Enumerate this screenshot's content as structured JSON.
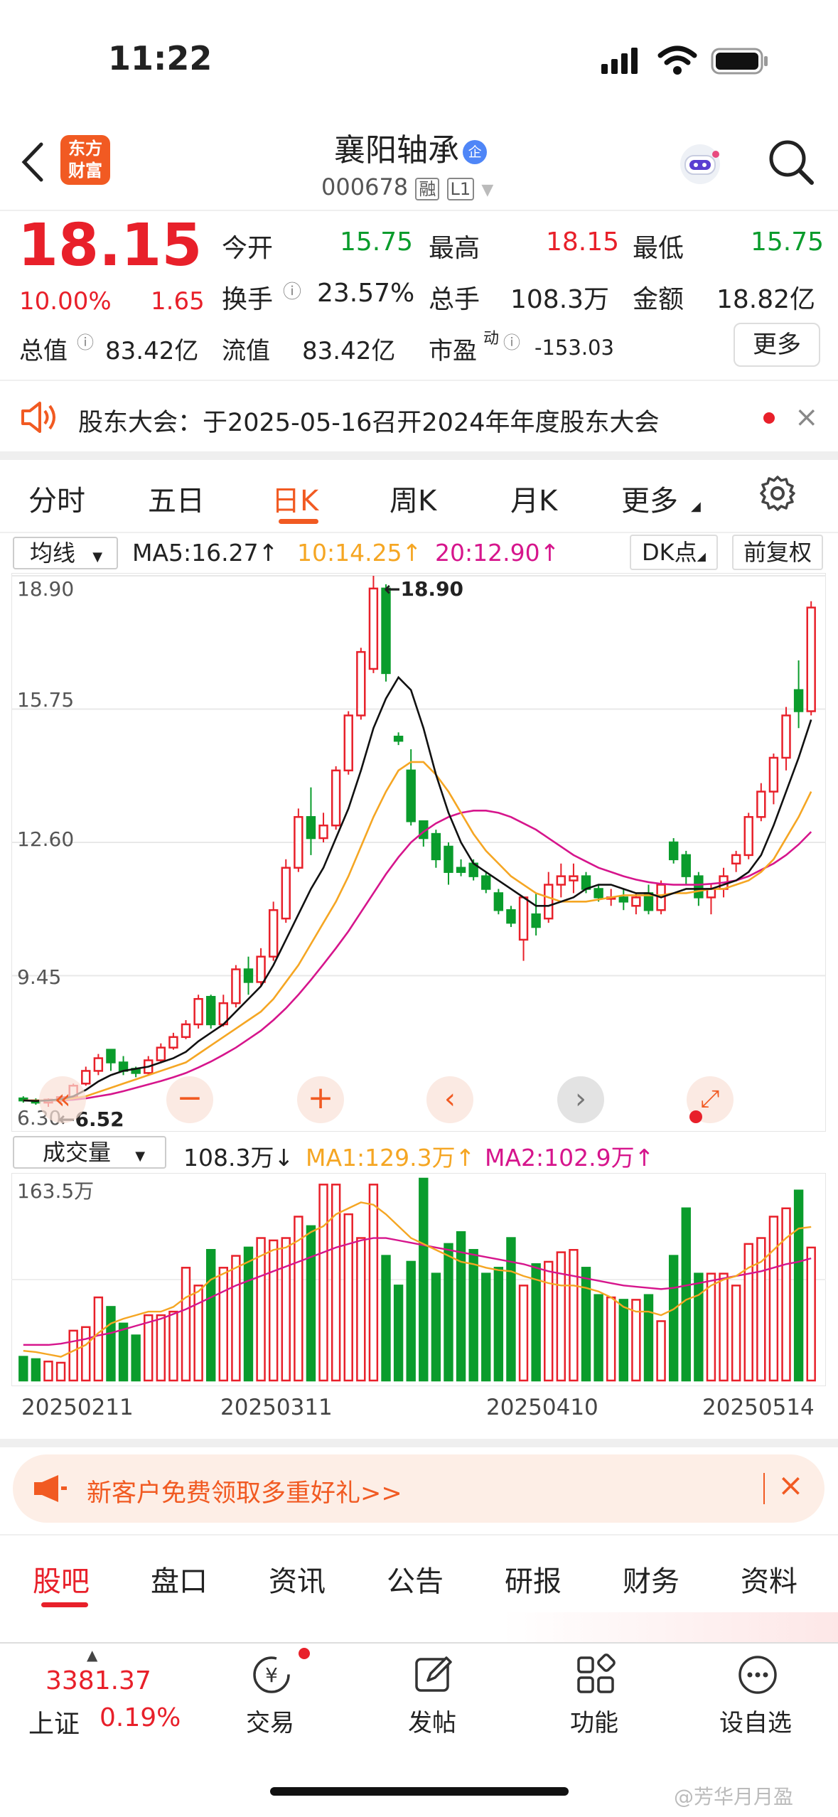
{
  "status_bar": {
    "time": "11:22"
  },
  "header": {
    "logo": "东方\n财富",
    "logo_line1": "东方",
    "logo_line2": "财富",
    "stock_name": "襄阳轴承",
    "badge": "企",
    "stock_code": "000678",
    "tag_rong": "融",
    "tag_level": "L1"
  },
  "quote": {
    "price": "18.15",
    "change_pct": "10.00%",
    "change": "1.65",
    "open_label": "今开",
    "open": "15.75",
    "high_label": "最高",
    "high": "18.15",
    "low_label": "最低",
    "low": "15.75",
    "turnover_label": "换手",
    "turnover": "23.57%",
    "volume_label": "总手",
    "volume": "108.3万",
    "amount_label": "金额",
    "amount": "18.82亿",
    "mktcap_label": "总值",
    "mktcap": "83.42亿",
    "float_label": "流值",
    "float_cap": "83.42亿",
    "pe_label": "市盈",
    "pe_sup": "动",
    "pe": "-153.03",
    "more_button": "更多"
  },
  "notice": {
    "text": "股东大会：于2025-05-16召开2024年年度股东大会"
  },
  "chart_tabs": [
    "分时",
    "五日",
    "日K",
    "周K",
    "月K",
    "更多"
  ],
  "active_tab": "日K",
  "ma_bar": {
    "selector": "均线",
    "ma5": "MA5:16.27↑",
    "ma10": "10:14.25↑",
    "ma20": "20:12.90↑",
    "dk": "DK点",
    "adj": "前复权"
  },
  "price_axis": [
    "18.90",
    "15.75",
    "12.60",
    "9.45",
    "6.30"
  ],
  "price_annotations": {
    "high_mark": "←18.90",
    "low_mark": "←6.52"
  },
  "volume_bar": {
    "selector": "成交量",
    "vol": "108.3万↓",
    "ma1": "MA1:129.3万↑",
    "ma2": "MA2:102.9万↑",
    "max_label": "163.5万"
  },
  "date_axis": [
    "20250211",
    "20250311",
    "20250410",
    "20250514"
  ],
  "promo": {
    "text": "新客户免费领取多重好礼>>"
  },
  "bottom_tabs": [
    "股吧",
    "盘口",
    "资讯",
    "公告",
    "研报",
    "财务",
    "资料"
  ],
  "active_bottom_tab": "股吧",
  "nav": {
    "index_value": "3381.37",
    "index_name": "上证",
    "index_change": "0.19%",
    "items": [
      "交易",
      "发帖",
      "功能",
      "设自选"
    ]
  },
  "watermark": "@芳华月月盈",
  "colors": {
    "up": "#e8202a",
    "down": "#0a9c2c",
    "accent": "#f15a22",
    "ma5": "#111111",
    "ma10": "#f5a623",
    "ma20": "#d6158c"
  },
  "chart_data": {
    "type": "candlestick",
    "price_axis_range": [
      6.3,
      18.9
    ],
    "candles": [
      [
        6.55,
        6.6,
        6.45,
        6.5
      ],
      [
        6.5,
        6.55,
        6.4,
        6.45
      ],
      [
        6.45,
        6.55,
        6.35,
        6.52
      ],
      [
        6.5,
        6.62,
        6.45,
        6.58
      ],
      [
        6.58,
        6.9,
        6.55,
        6.85
      ],
      [
        6.9,
        7.3,
        6.85,
        7.2
      ],
      [
        7.2,
        7.6,
        7.1,
        7.5
      ],
      [
        7.7,
        7.6,
        7.2,
        7.4
      ],
      [
        7.4,
        7.55,
        7.1,
        7.2
      ],
      [
        7.25,
        7.3,
        7.05,
        7.15
      ],
      [
        7.15,
        7.55,
        7.1,
        7.45
      ],
      [
        7.45,
        7.85,
        7.4,
        7.75
      ],
      [
        7.75,
        8.1,
        7.7,
        8.0
      ],
      [
        8.0,
        8.4,
        7.95,
        8.3
      ],
      [
        8.3,
        9.0,
        8.2,
        8.9
      ],
      [
        8.95,
        9.0,
        8.2,
        8.3
      ],
      [
        8.3,
        9.0,
        8.25,
        8.8
      ],
      [
        8.8,
        9.7,
        8.7,
        9.6
      ],
      [
        9.6,
        9.9,
        9.0,
        9.3
      ],
      [
        9.3,
        10.1,
        9.2,
        9.9
      ],
      [
        9.9,
        11.2,
        9.8,
        11.0
      ],
      [
        10.8,
        12.2,
        10.7,
        12.0
      ],
      [
        12.0,
        13.4,
        11.9,
        13.2
      ],
      [
        13.2,
        13.9,
        12.3,
        12.7
      ],
      [
        12.7,
        13.3,
        12.6,
        13.0
      ],
      [
        13.0,
        14.4,
        12.9,
        14.3
      ],
      [
        14.3,
        15.7,
        14.2,
        15.6
      ],
      [
        15.6,
        17.2,
        15.5,
        17.1
      ],
      [
        16.7,
        18.9,
        16.6,
        18.6
      ],
      [
        18.6,
        18.7,
        16.4,
        16.6
      ],
      [
        15.1,
        15.2,
        14.9,
        15.0
      ],
      [
        14.3,
        14.8,
        13.0,
        13.1
      ],
      [
        13.1,
        13.1,
        12.5,
        12.7
      ],
      [
        12.8,
        12.9,
        12.0,
        12.2
      ],
      [
        12.5,
        12.6,
        11.6,
        11.9
      ],
      [
        12.0,
        12.2,
        11.8,
        11.9
      ],
      [
        12.1,
        12.2,
        11.7,
        11.8
      ],
      [
        11.8,
        11.9,
        11.4,
        11.5
      ],
      [
        11.4,
        11.5,
        10.9,
        11.0
      ],
      [
        11.0,
        11.1,
        10.6,
        10.7
      ],
      [
        10.3,
        11.3,
        9.8,
        11.3
      ],
      [
        10.9,
        11.4,
        10.4,
        10.6
      ],
      [
        10.8,
        11.9,
        10.7,
        11.6
      ],
      [
        11.6,
        12.1,
        11.3,
        11.8
      ],
      [
        11.7,
        12.1,
        11.4,
        11.8
      ],
      [
        11.8,
        11.9,
        11.4,
        11.5
      ],
      [
        11.5,
        11.6,
        11.2,
        11.3
      ],
      [
        11.3,
        11.5,
        11.1,
        11.3
      ],
      [
        11.3,
        11.5,
        11.0,
        11.2
      ],
      [
        11.1,
        11.4,
        10.9,
        11.3
      ],
      [
        11.4,
        11.6,
        10.9,
        11.0
      ],
      [
        11.0,
        11.7,
        10.9,
        11.6
      ],
      [
        12.6,
        12.7,
        12.1,
        12.2
      ],
      [
        12.3,
        12.4,
        11.6,
        11.8
      ],
      [
        11.8,
        11.9,
        11.1,
        11.3
      ],
      [
        11.3,
        11.6,
        10.9,
        11.5
      ],
      [
        11.5,
        12.0,
        11.3,
        11.8
      ],
      [
        12.1,
        12.4,
        11.9,
        12.3
      ],
      [
        12.3,
        13.3,
        12.2,
        13.2
      ],
      [
        13.2,
        14.0,
        13.1,
        13.8
      ],
      [
        13.8,
        14.7,
        13.5,
        14.6
      ],
      [
        14.6,
        15.8,
        14.3,
        15.6
      ],
      [
        16.2,
        16.9,
        15.3,
        15.7
      ],
      [
        15.7,
        18.3,
        15.6,
        18.15
      ]
    ],
    "ma5": [
      6.5,
      6.49,
      6.5,
      6.53,
      6.6,
      6.75,
      6.95,
      7.1,
      7.2,
      7.25,
      7.3,
      7.4,
      7.5,
      7.65,
      7.9,
      8.1,
      8.3,
      8.6,
      8.9,
      9.2,
      9.7,
      10.3,
      10.9,
      11.5,
      12.0,
      12.7,
      13.4,
      14.3,
      15.3,
      16.0,
      16.5,
      16.2,
      15.3,
      14.2,
      13.3,
      12.6,
      12.1,
      11.9,
      11.7,
      11.5,
      11.3,
      11.1,
      11.1,
      11.2,
      11.3,
      11.5,
      11.6,
      11.6,
      11.5,
      11.4,
      11.4,
      11.3,
      11.4,
      11.5,
      11.5,
      11.5,
      11.6,
      11.7,
      11.9,
      12.3,
      13.0,
      13.8,
      14.6,
      15.5
    ],
    "ma10": [
      6.5,
      6.5,
      6.5,
      6.51,
      6.55,
      6.6,
      6.7,
      6.8,
      6.9,
      7.0,
      7.1,
      7.2,
      7.3,
      7.4,
      7.6,
      7.8,
      8.0,
      8.2,
      8.4,
      8.6,
      8.9,
      9.3,
      9.7,
      10.2,
      10.7,
      11.2,
      11.8,
      12.5,
      13.2,
      13.8,
      14.3,
      14.5,
      14.5,
      14.2,
      13.8,
      13.3,
      12.8,
      12.4,
      12.1,
      11.8,
      11.6,
      11.4,
      11.3,
      11.2,
      11.2,
      11.2,
      11.25,
      11.3,
      11.35,
      11.35,
      11.35,
      11.35,
      11.4,
      11.4,
      11.45,
      11.5,
      11.5,
      11.6,
      11.7,
      11.9,
      12.2,
      12.7,
      13.2,
      13.8
    ],
    "ma20": [
      6.5,
      6.5,
      6.5,
      6.5,
      6.52,
      6.55,
      6.6,
      6.65,
      6.72,
      6.8,
      6.88,
      6.96,
      7.05,
      7.15,
      7.28,
      7.42,
      7.58,
      7.75,
      7.95,
      8.15,
      8.4,
      8.68,
      9.0,
      9.35,
      9.72,
      10.1,
      10.5,
      10.95,
      11.4,
      11.85,
      12.25,
      12.6,
      12.85,
      13.05,
      13.2,
      13.3,
      13.35,
      13.35,
      13.3,
      13.2,
      13.05,
      12.9,
      12.7,
      12.5,
      12.3,
      12.15,
      12.0,
      11.9,
      11.8,
      11.72,
      11.66,
      11.62,
      11.6,
      11.6,
      11.6,
      11.62,
      11.65,
      11.7,
      11.8,
      11.95,
      12.1,
      12.3,
      12.55,
      12.85
    ],
    "volume_axis_max": "163.5万",
    "volumes": [
      20,
      18,
      16,
      15,
      42,
      45,
      70,
      62,
      48,
      38,
      55,
      55,
      58,
      95,
      80,
      110,
      95,
      105,
      112,
      120,
      118,
      120,
      138,
      130,
      165,
      165,
      140,
      120,
      165,
      105,
      80,
      100,
      170,
      90,
      115,
      125,
      110,
      90,
      95,
      120,
      80,
      98,
      100,
      108,
      110,
      95,
      72,
      70,
      68,
      68,
      72,
      50,
      105,
      145,
      90,
      90,
      90,
      80,
      115,
      120,
      138,
      145,
      160,
      112
    ],
    "vol_ma1": [
      25,
      24,
      22,
      20,
      25,
      30,
      40,
      48,
      52,
      55,
      58,
      58,
      62,
      70,
      75,
      85,
      90,
      95,
      100,
      105,
      110,
      112,
      118,
      125,
      130,
      140,
      145,
      150,
      148,
      140,
      130,
      120,
      115,
      110,
      105,
      100,
      98,
      95,
      93,
      92,
      88,
      85,
      82,
      80,
      80,
      78,
      75,
      70,
      62,
      58,
      58,
      55,
      60,
      68,
      72,
      80,
      85,
      88,
      95,
      100,
      110,
      120,
      128,
      129.3
    ],
    "vol_ma2": [
      30,
      30,
      30,
      31,
      33,
      35,
      38,
      40,
      43,
      46,
      49,
      52,
      56,
      60,
      65,
      70,
      75,
      80,
      84,
      88,
      92,
      96,
      100,
      104,
      108,
      112,
      115,
      118,
      120,
      120,
      118,
      116,
      114,
      112,
      110,
      108,
      106,
      104,
      102,
      100,
      98,
      95,
      92,
      90,
      88,
      86,
      84,
      82,
      80,
      79,
      78,
      77,
      78,
      80,
      82,
      84,
      86,
      88,
      90,
      92,
      95,
      98,
      100,
      102.9
    ]
  }
}
